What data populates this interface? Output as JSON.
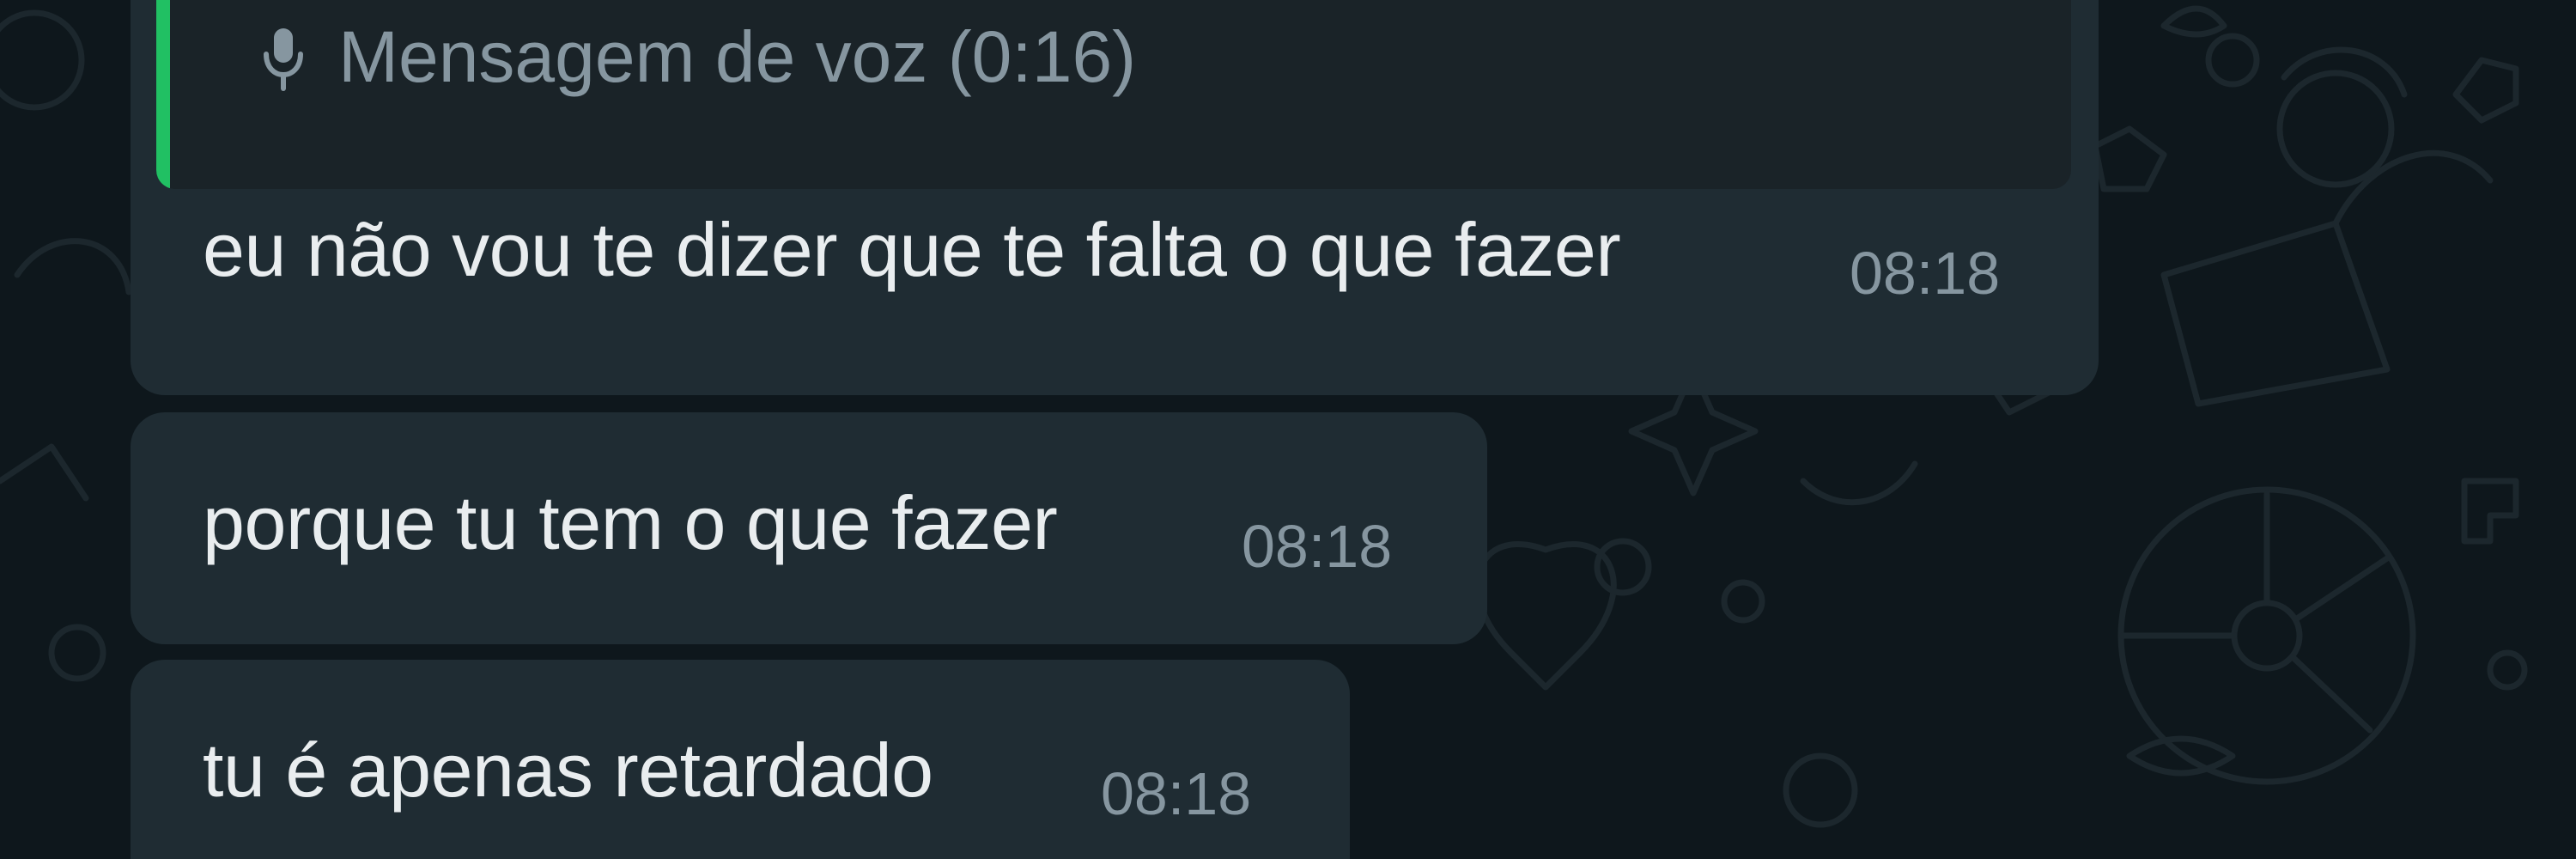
{
  "messages": [
    {
      "reply_preview": {
        "icon": "mic-icon",
        "label": "Mensagem de voz (0:16)",
        "accent_color": "#21c063"
      },
      "text": "eu não vou te dizer que te falta o que fazer",
      "time": "08:18"
    },
    {
      "text": "porque tu tem o que fazer",
      "time": "08:18"
    },
    {
      "text": "tu é apenas retardado",
      "time": "08:18"
    }
  ],
  "colors": {
    "bubble": "#1f2c33",
    "background": "#0e171c",
    "text": "#e9edef",
    "meta": "#8696a0"
  }
}
